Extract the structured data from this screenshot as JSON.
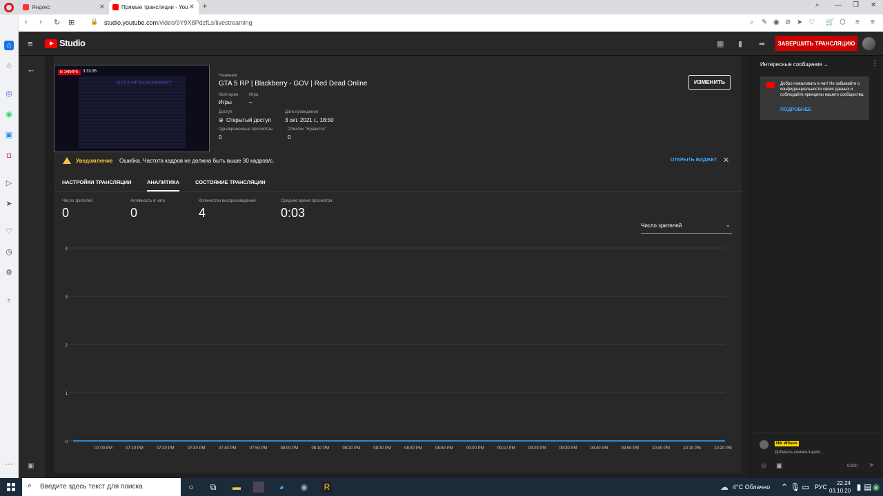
{
  "browser": {
    "tabs": [
      {
        "label": "Яндекс",
        "favicon_color": "#f33"
      },
      {
        "label": "Прямые трансляции - You",
        "favicon_color": "#f00"
      }
    ],
    "new_tab": "+",
    "url_host": "studio.youtube.com",
    "url_path": "/video/9Y9X8PdzfLs/livestreaming"
  },
  "studio": {
    "logo_text": "Studio",
    "end_stream_label": "ЗАВЕРШИТЬ ТРАНСЛЯЦИЮ",
    "edit_label": "ИЗМЕНИТЬ",
    "thumbnail": {
      "live_badge": "В ЭФИРЕ",
      "duration": "3:33:35",
      "overlay_text": "GTA 5 RP BLACKBERRY"
    },
    "info": {
      "title_label": "Название",
      "title": "GTA 5 RP | Blackberry - GOV | Red Dead Online",
      "category_label": "Категория",
      "category": "Игры",
      "game_label": "Игра",
      "game": "–",
      "access_label": "Доступ",
      "access": "Открытый доступ",
      "date_label": "Дата проведения",
      "date": "3 окт. 2021 г., 18:50",
      "concurrent_label": "Одновременные просмотры",
      "concurrent": "0",
      "likes_label": "Отметки \"Нравится\"",
      "likes": "0"
    },
    "warning": {
      "label": "Уведомление",
      "text": "Ошибка. Частота кадров не должна быть выше 30 кадров/с.",
      "link": "ОТКРЫТЬ ВИДЖЕТ"
    },
    "tabs": [
      {
        "label": "НАСТРОЙКИ ТРАНСЛЯЦИИ"
      },
      {
        "label": "АНАЛИТИКА"
      },
      {
        "label": "СОСТОЯНИЕ ТРАНСЛЯЦИИ"
      }
    ],
    "metrics": [
      {
        "label": "Число зрителей",
        "value": "0"
      },
      {
        "label": "Активность в чате",
        "value": "0"
      },
      {
        "label": "Количество воспроизведений",
        "value": "4"
      },
      {
        "label": "Среднее время просмотра",
        "value": "0:03"
      }
    ],
    "chart_select": "Число зрителей"
  },
  "chart_data": {
    "type": "line",
    "title": "",
    "xlabel": "",
    "ylabel": "",
    "ylim": [
      0,
      4
    ],
    "yticks": [
      "0",
      "1",
      "2",
      "3",
      "4"
    ],
    "categories": [
      "07:00 PM",
      "07:10 PM",
      "07:20 PM",
      "07:30 PM",
      "07:40 PM",
      "07:50 PM",
      "08:00 PM",
      "08:10 PM",
      "08:20 PM",
      "08:30 PM",
      "08:40 PM",
      "08:50 PM",
      "09:00 PM",
      "09:10 PM",
      "09:20 PM",
      "09:30 PM",
      "09:40 PM",
      "09:50 PM",
      "10:00 PM",
      "10:10 PM",
      "10:20 PM"
    ],
    "series": [
      {
        "values": [
          0,
          0,
          0,
          0,
          0,
          0,
          0,
          0,
          0,
          0,
          0,
          0,
          0,
          0,
          0,
          0,
          0,
          0,
          0,
          0,
          0
        ]
      }
    ],
    "grid": true,
    "line_color": "#3ea6ff"
  },
  "chat": {
    "title": "Интересные сообщения",
    "pinned_text": "Добро пожаловать в чат! Не забывайте о конфиденциальности своих данных и соблюдайте принципы нашего сообщества.",
    "pinned_link": "ПОДРОБНЕЕ",
    "user_name": "Nik Wilson",
    "input_placeholder": "Добавить комментарий...",
    "counter": "0/200"
  },
  "taskbar": {
    "search_placeholder": "Введите здесь текст для поиска",
    "weather": "4°C Облачно",
    "lang": "РУС",
    "time": "22:24",
    "date": "03.10.20"
  }
}
